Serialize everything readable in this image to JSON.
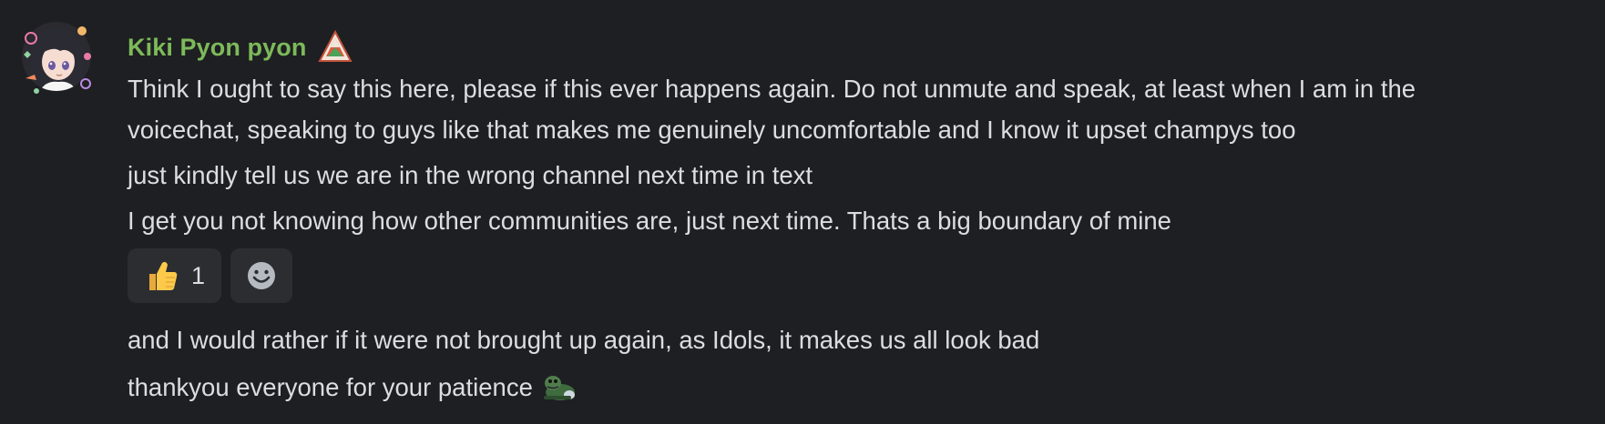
{
  "message": {
    "author": "Kiki Pyon pyon",
    "author_color": "#7dba5a",
    "role_icon": "kiki-role-icon",
    "lines": [
      "Think I ought to say this here, please if this ever happens again. Do not unmute and speak, at least when I am in the",
      "voicechat, speaking to guys like that makes me genuinely uncomfortable and I know it upset champys too",
      "just kindly tell us we are in the wrong channel next time in text",
      "I get you not knowing how other communities are, just next time. Thats a big boundary of mine",
      "and I would rather if it were not brought up again, as Idols, it makes us all look bad",
      "thankyou everyone for your patience"
    ],
    "inline_emoji": "custom-frog-emoji"
  },
  "reactions": [
    {
      "emoji": "thumbs-up-icon",
      "count": "1"
    },
    {
      "emoji": "add-reaction-icon",
      "count": ""
    }
  ],
  "colors": {
    "background": "#1e1f22",
    "text": "#dbdee1",
    "reaction_bg": "#2b2d31"
  }
}
